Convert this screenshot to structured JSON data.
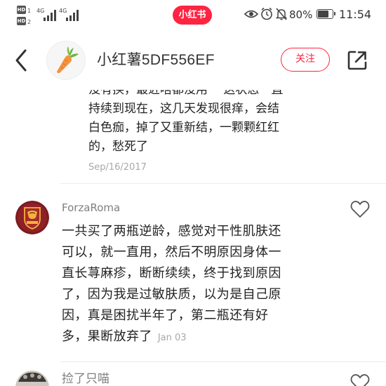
{
  "status_bar": {
    "sim1": {
      "label": "HD",
      "num": "1"
    },
    "sim2": {
      "label": "HD",
      "num": "2"
    },
    "net1": "4G",
    "net2": "4G",
    "app_badge": "小红书",
    "battery_percent": "80%",
    "battery_level": 0.8,
    "time": "11:54",
    "icons": [
      "eye-icon",
      "alarm-icon",
      "mute-bell-icon",
      "battery-icon"
    ]
  },
  "header": {
    "title": "小红薯5DF556EF",
    "follow_label": "关注",
    "back_icon": "back-arrow-icon",
    "avatar_icon": "carrot-icon",
    "share_icon": "share-icon"
  },
  "comments": {
    "previous": {
      "text_lines": [
        "没有换，最近啥都没用 一这状态一直",
        "持续到现在，这几天发现很痒，会结",
        "白色痂，掉了又重新结，一颗颗红红",
        "的，愁死了"
      ],
      "date": "Sep/16/2017"
    },
    "items": [
      {
        "user": "ForzaRoma",
        "body_lines": [
          "一共买了两瓶逆龄，感觉对干性肌肤还",
          "可以，就一直用，然后不明原因身体一",
          "直长荨麻疹，断断续续，终于找到原因",
          "了，因为我是过敏肤质，以为是自己原",
          "因，真是困扰半年了，第二瓶还有好",
          "多，果断放弃了"
        ],
        "date": "Jan 03",
        "avatar_icon": "roma-crest-icon",
        "like_icon": "heart-icon"
      },
      {
        "user": "捡了只喵",
        "avatar_icon": "cat-avatar-icon",
        "like_icon": "heart-icon"
      }
    ]
  },
  "colors": {
    "brand_red": "#ff2442",
    "text_primary": "#222222",
    "text_secondary": "#7f7f7f",
    "text_date": "#a8a8a8",
    "divider": "#ececec"
  }
}
